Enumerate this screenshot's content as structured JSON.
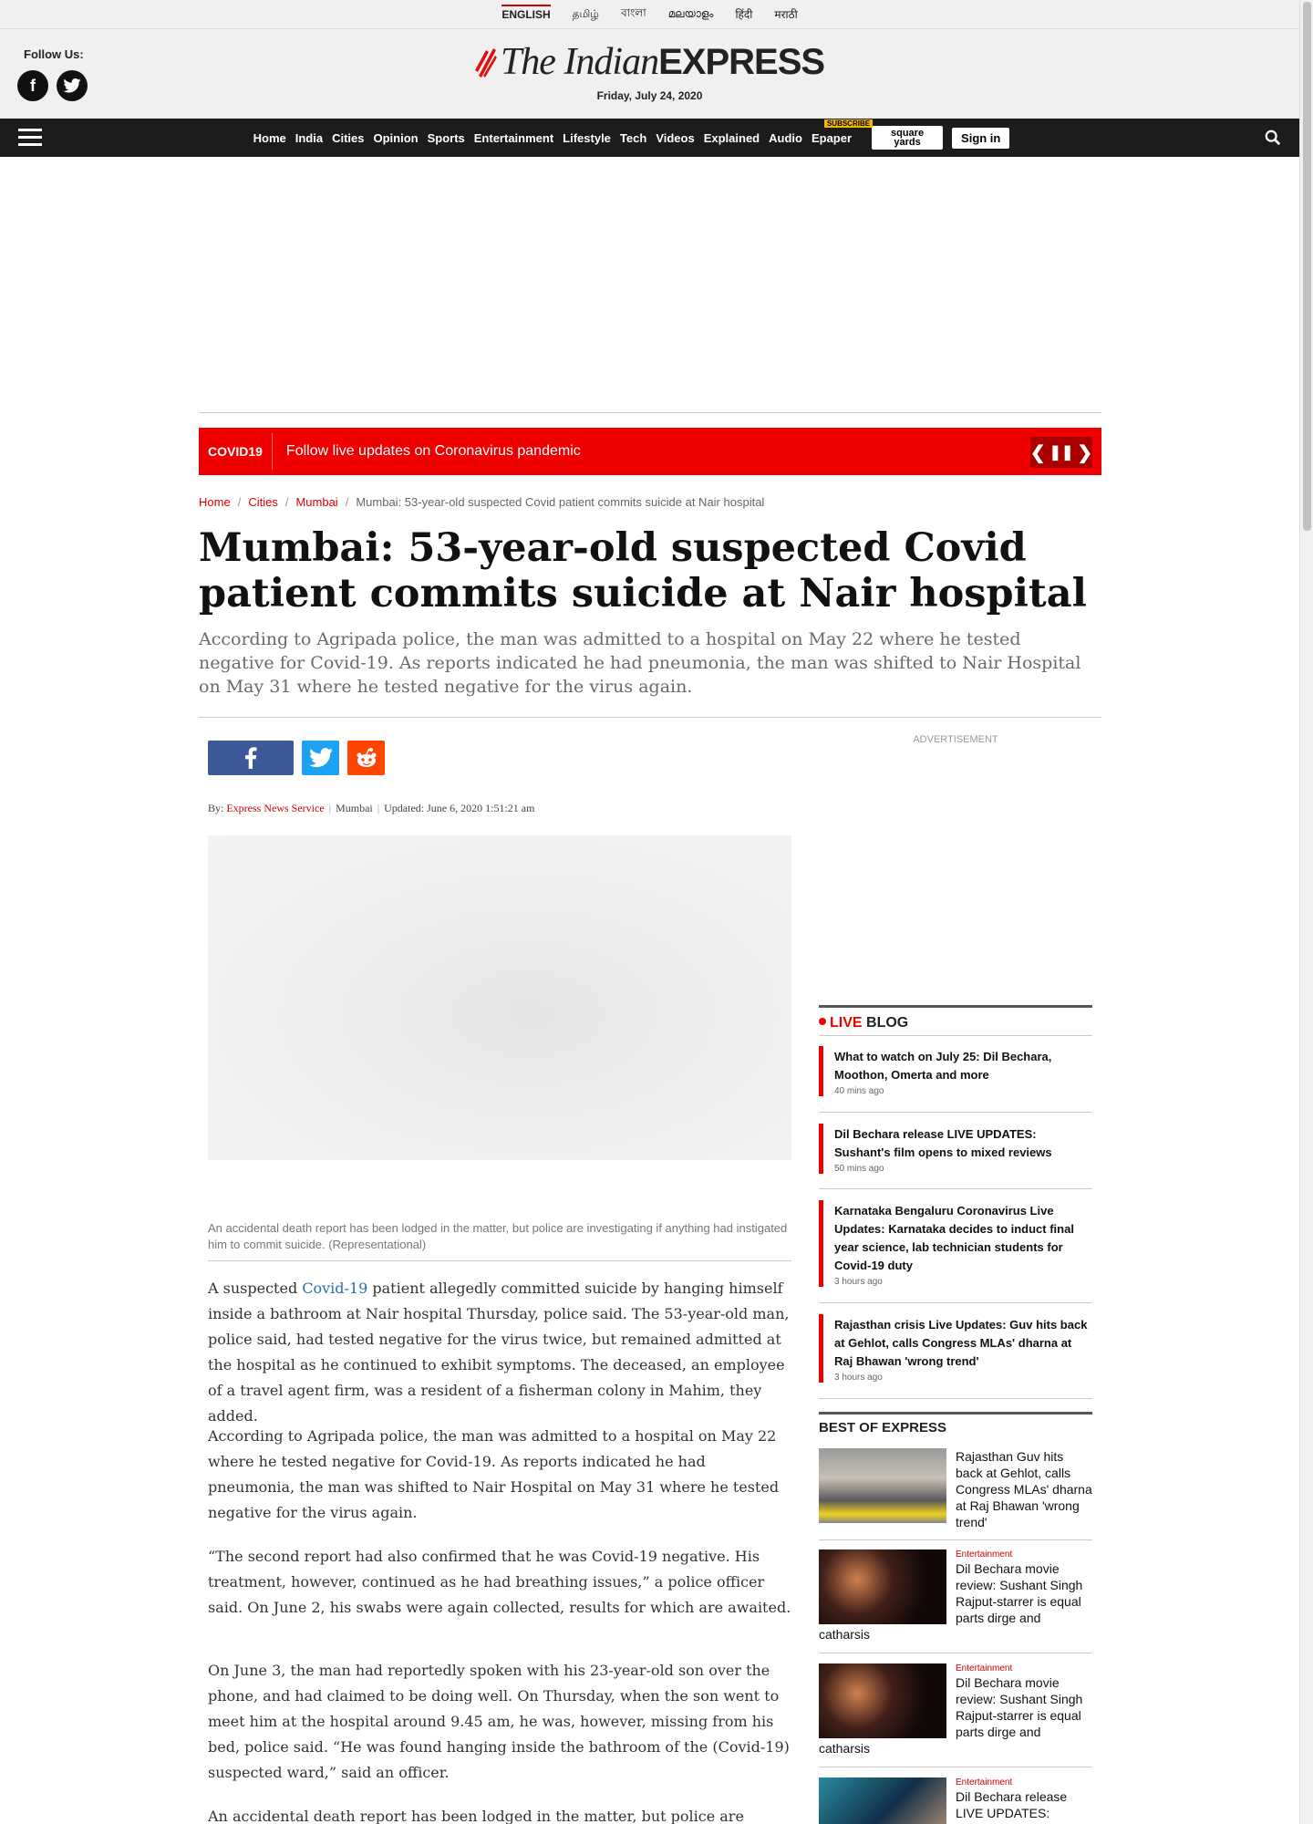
{
  "langs": [
    "ENGLISH",
    "தமிழ்",
    "বাংলা",
    "മലയാളം",
    "हिंदी",
    "मराठी"
  ],
  "masthead": {
    "follow": "Follow Us:",
    "logo_the": "The Indian",
    "logo_express": "EXPRESS",
    "date": "Friday, July 24, 2020",
    "fb": "f",
    "tw": "t"
  },
  "nav": {
    "items": [
      "Home",
      "India",
      "Cities",
      "Opinion",
      "Sports",
      "Entertainment",
      "Lifestyle",
      "Tech",
      "Videos",
      "Explained",
      "Audio",
      "Epaper"
    ],
    "subscribe": "SUBSCRIBE",
    "square": "square yards",
    "signin": "Sign in"
  },
  "covid": {
    "tag": "COVID19",
    "text": "Follow live updates on Coronavirus pandemic",
    "prev": "❮",
    "pause": "❚❚",
    "next": "❯"
  },
  "breadcrumb": {
    "home": "Home",
    "cities": "Cities",
    "city": "Mumbai",
    "current": "Mumbai: 53-year-old suspected Covid patient commits suicide at Nair hospital"
  },
  "article": {
    "headline": "Mumbai: 53-year-old suspected Covid patient commits suicide at Nair hospital",
    "subhead": "According to Agripada police, the man was admitted to a hospital on May 22 where he tested negative for Covid-19. As reports indicated he had pneumonia, the man was shifted to Nair Hospital on May 31 where he tested negative for the virus again.",
    "by": "By:",
    "author": "Express News Service",
    "location": "Mumbai",
    "updated": "Updated: June 6, 2020 1:51:21 am",
    "caption": "An accidental death report has been lodged in the matter, but police are investigating if anything had instigated him to commit suicide. (Representational)",
    "p1_a": "A suspected ",
    "p1_link": "Covid-19",
    "p1_b": " patient allegedly committed suicide by hanging himself inside a bathroom at Nair hospital Thursday, police said. The 53-year-old man, police said, had tested negative for the virus twice, but remained admitted at the hospital as he continued to exhibit symptoms. The deceased, an employee of a travel agent firm, was a resident of a fisherman colony in Mahim, they added.",
    "p2": "According to Agripada police, the man was admitted to a hospital on May 22 where he tested negative for Covid-19. As reports indicated he had pneumonia, the man was shifted to Nair Hospital on May 31 where he tested negative for the virus again.",
    "p3": "“The second report had also confirmed that he was Covid-19 negative. His treatment, however, continued as he had breathing issues,” a police officer said. On June 2, his swabs were again collected, results for which are awaited.",
    "p4": "On June 3, the man had reportedly spoken with his 23-year-old son over the phone, and had claimed to be doing well. On Thursday, when the son went to meet him at the hospital around 9.45 am, he was, however, missing from his bed, police said. “He was found hanging inside the bathroom of the (Covid-19) suspected ward,” said an officer.",
    "p5": "An accidental death report has been lodged in the matter, but police are"
  },
  "sidebar": {
    "adv": "ADVERTISEMENT",
    "live_label": "LIVE",
    "blog_label": "BLOG",
    "live": [
      {
        "title": "What to watch on July 25: Dil Bechara, Moothon, Omerta and more",
        "time": "40 mins ago"
      },
      {
        "title": "Dil Bechara release LIVE UPDATES: Sushant's film opens to mixed reviews",
        "time": "50 mins ago"
      },
      {
        "title": "Karnataka Bengaluru Coronavirus Live Updates: Karnataka decides to induct final year science, lab technician students for Covid-19 duty",
        "time": "3 hours ago"
      },
      {
        "title": "Rajasthan crisis Live Updates: Guv hits back at Gehlot, calls Congress MLAs' dharna at Raj Bhawan 'wrong trend'",
        "time": "3 hours ago"
      }
    ],
    "best_head": "BEST OF EXPRESS",
    "best": [
      {
        "cat": "",
        "title": "Rajasthan Guv hits back at Gehlot, calls Congress MLAs' dharna at Raj Bhawan 'wrong trend'"
      },
      {
        "cat": "Entertainment",
        "title": "Dil Bechara movie review: Sushant Singh Rajput-starrer is equal parts dirge and catharsis"
      },
      {
        "cat": "Entertainment",
        "title": "Dil Bechara movie review: Sushant Singh Rajput-starrer is equal parts dirge and catharsis"
      },
      {
        "cat": "Entertainment",
        "title": "Dil Bechara release LIVE UPDATES: Celebs and"
      }
    ]
  },
  "colors": {
    "accent": "#e00000",
    "nav_bg": "#1c1c1c",
    "link": "#2a6cb0"
  }
}
